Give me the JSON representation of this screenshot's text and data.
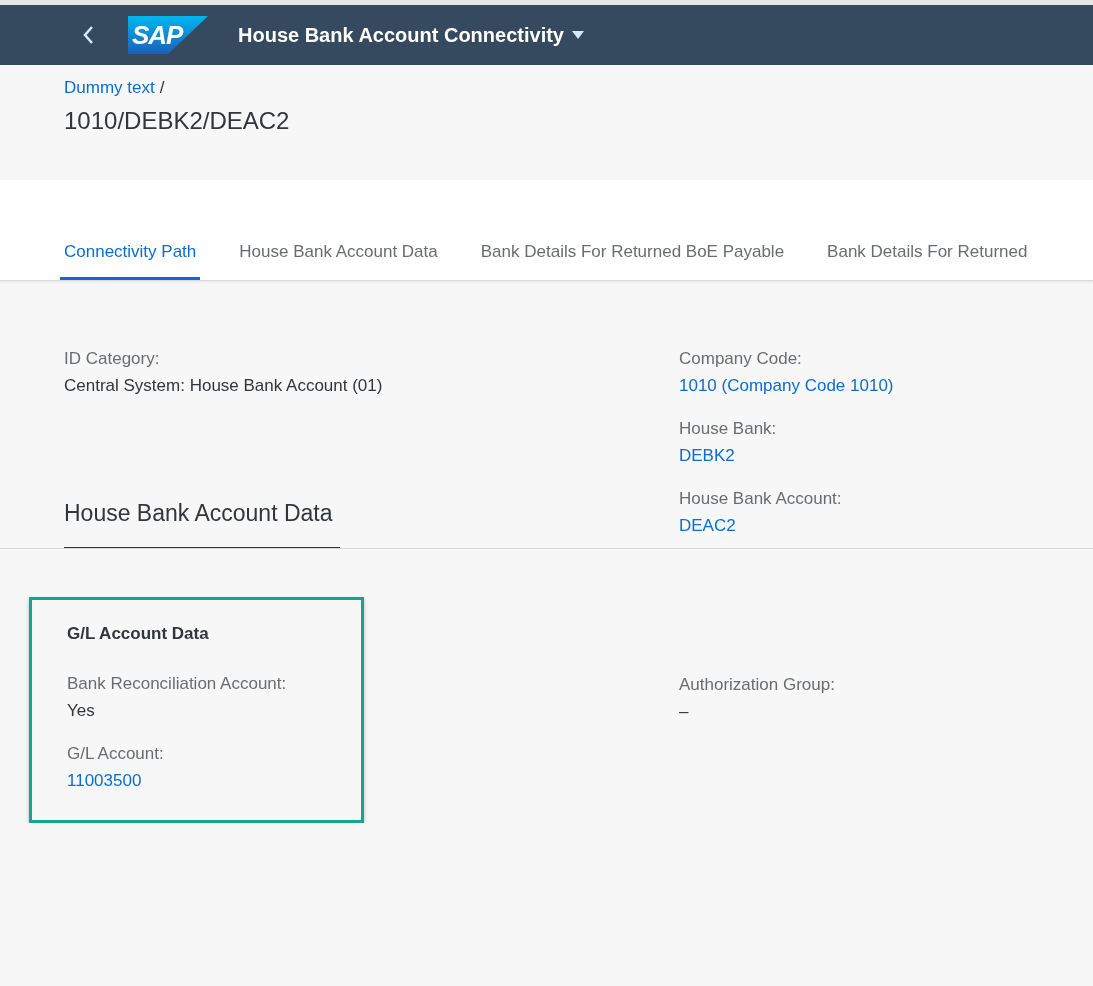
{
  "shell": {
    "logo": "SAP",
    "title": "House Bank Account Connectivity"
  },
  "breadcrumb": {
    "link": "Dummy text",
    "separator": "/"
  },
  "object_title": "1010/DEBK2/DEAC2",
  "tabs": [
    {
      "label": "Connectivity Path",
      "selected": true
    },
    {
      "label": "House Bank Account Data",
      "selected": false
    },
    {
      "label": "Bank Details For Returned BoE Payable",
      "selected": false
    },
    {
      "label": "Bank Details For Returned",
      "selected": false
    }
  ],
  "connectivity_path": {
    "left": [
      {
        "label": "ID Category:",
        "value": "Central System: House Bank Account (01)",
        "kind": "text"
      }
    ],
    "right": [
      {
        "label": "Company Code:",
        "value": "1010 (Company Code 1010)",
        "kind": "link"
      },
      {
        "label": "House Bank:",
        "value": "DEBK2",
        "kind": "link"
      },
      {
        "label": "House Bank Account:",
        "value": "DEAC2",
        "kind": "link"
      }
    ]
  },
  "section": {
    "title": "House Bank Account Data",
    "group": {
      "title": "G/L Account Data",
      "highlighted": true,
      "fields": [
        {
          "label": "Bank Reconciliation Account:",
          "value": "Yes",
          "kind": "text"
        },
        {
          "label": "G/L Account:",
          "value": "11003500",
          "kind": "link"
        }
      ]
    },
    "right": [
      {
        "label": "Authorization Group:",
        "value": "–",
        "kind": "text"
      }
    ]
  }
}
